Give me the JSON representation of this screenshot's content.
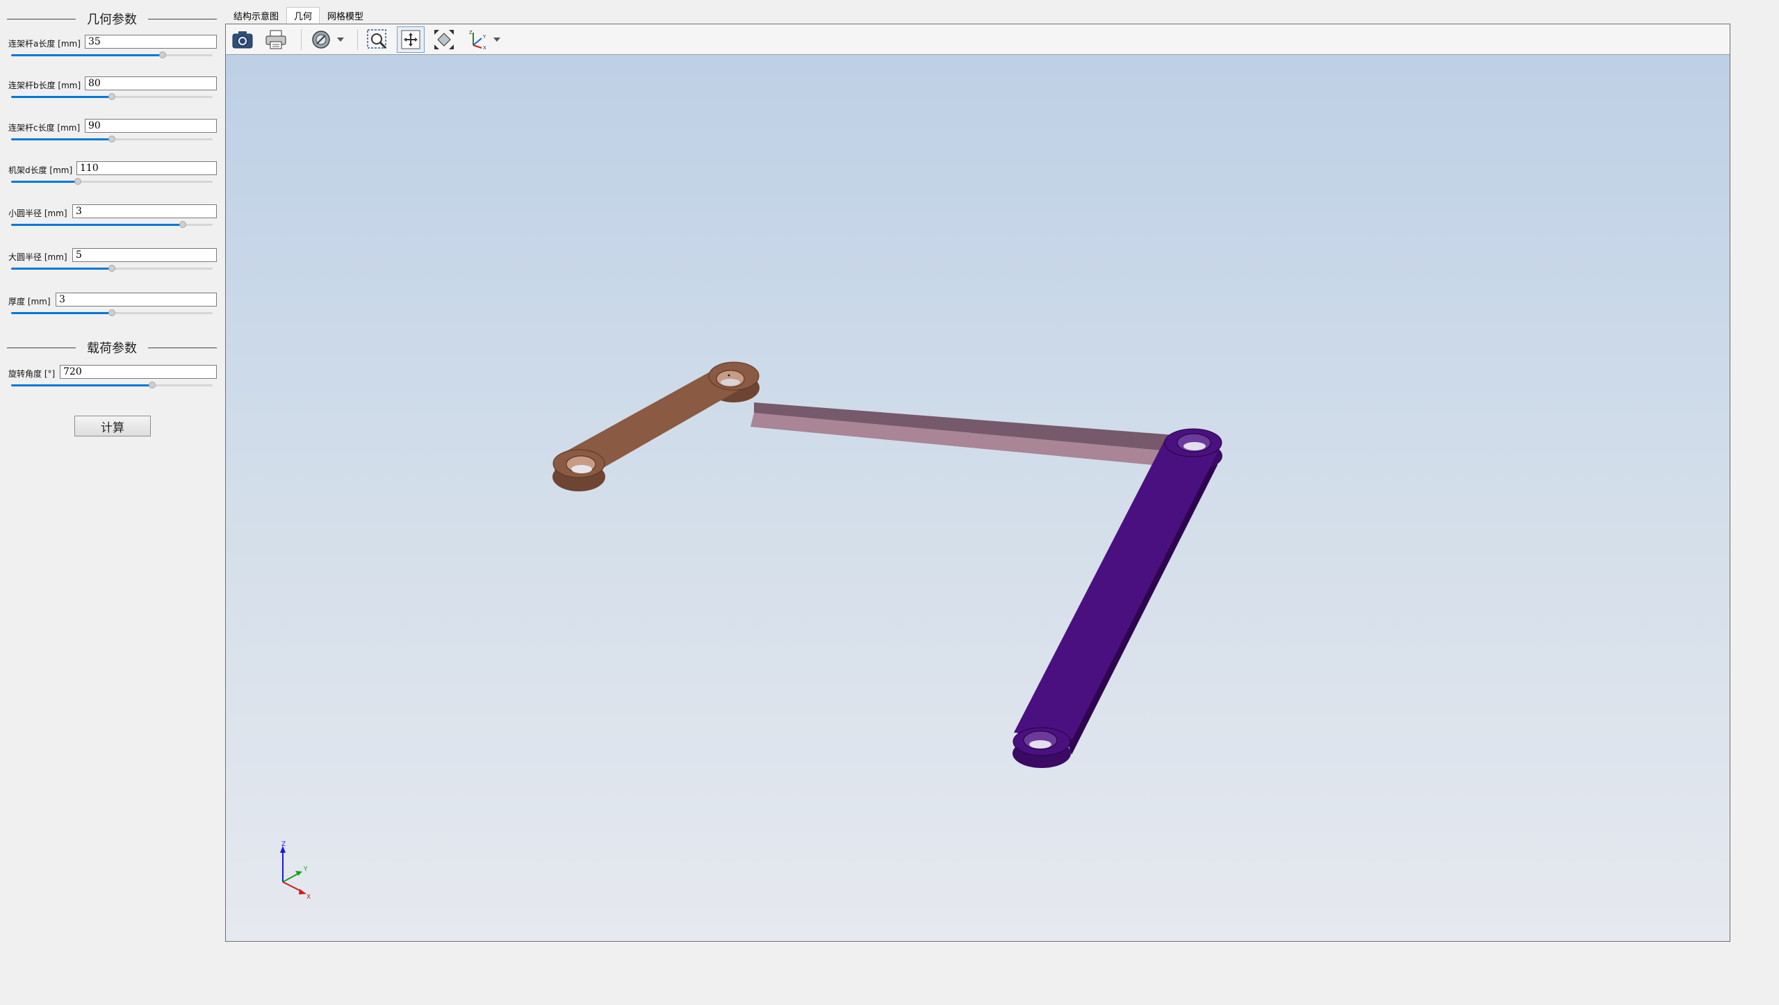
{
  "left_panel": {
    "geometry_title": "几何参数",
    "load_title": "载荷参数",
    "params": [
      {
        "label": "连架杆a长度 [mm]",
        "value": "35",
        "slider": 0.75
      },
      {
        "label": "连架杆b长度 [mm]",
        "value": "80",
        "slider": 0.5
      },
      {
        "label": "连架杆c长度 [mm]",
        "value": "90",
        "slider": 0.5
      },
      {
        "label": "机架d长度 [mm]",
        "value": "110",
        "slider": 0.33
      },
      {
        "label": "小圆半径 [mm]",
        "value": "3",
        "slider": 0.85
      },
      {
        "label": "大圆半径 [mm]",
        "value": "5",
        "slider": 0.5
      },
      {
        "label": "厚度 [mm]",
        "value": "3",
        "slider": 0.5
      }
    ],
    "load_params": [
      {
        "label": "旋转角度 [°]",
        "value": "720",
        "slider": 0.7
      }
    ],
    "calc_label": "计算"
  },
  "tabs": [
    {
      "label": "结构示意图",
      "active": false
    },
    {
      "label": "几何",
      "active": true
    },
    {
      "label": "网格模型",
      "active": false
    }
  ],
  "toolbar": {
    "buttons": [
      "camera-icon",
      "print-icon",
      "display-mode-icon",
      "zoom-window-icon",
      "pan-icon",
      "fit-all-icon",
      "axes-view-icon"
    ]
  },
  "axis_labels": {
    "x": "X",
    "y": "Y",
    "z": "Z"
  },
  "colors": {
    "link_a": "#8b5a42",
    "link_b": "#7a5c6a",
    "link_c": "#4b1080",
    "accent": "#0078d7"
  }
}
